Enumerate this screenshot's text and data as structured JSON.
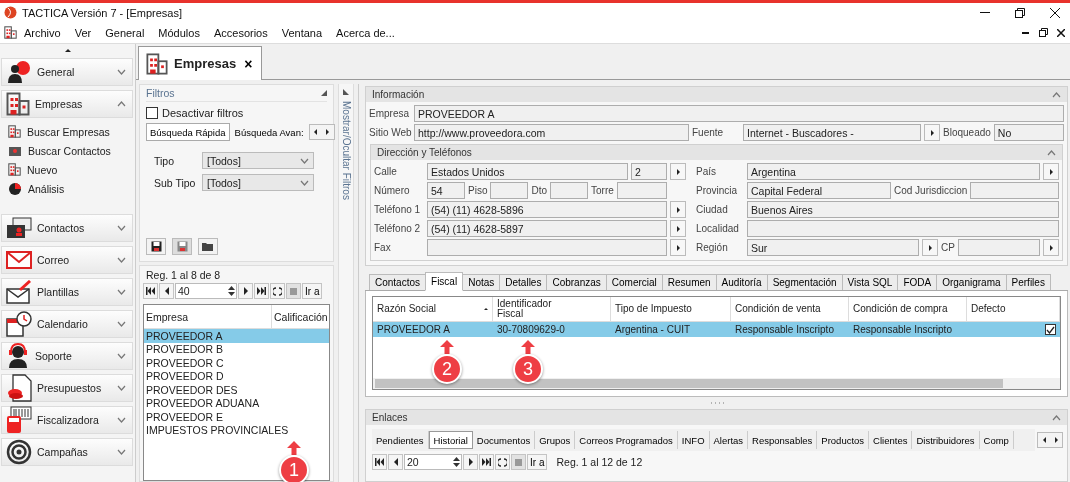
{
  "window": {
    "title": "TACTICA Versión 7 - [Empresas]"
  },
  "menu": [
    {
      "label": "Archivo"
    },
    {
      "label": "Ver"
    },
    {
      "label": "General"
    },
    {
      "label": "Módulos"
    },
    {
      "label": "Accesorios"
    },
    {
      "label": "Ventana"
    },
    {
      "label": "Acerca de..."
    }
  ],
  "sidebar": {
    "groups": [
      {
        "label": "General",
        "expanded": false
      },
      {
        "label": "Empresas",
        "expanded": true,
        "items": [
          {
            "label": "Buscar Empresas"
          },
          {
            "label": "Buscar Contactos"
          },
          {
            "label": "Nuevo"
          },
          {
            "label": "Análisis"
          }
        ]
      },
      {
        "label": "Contactos",
        "expanded": false
      },
      {
        "label": "Correo",
        "expanded": false
      },
      {
        "label": "Plantillas",
        "expanded": false
      },
      {
        "label": "Calendario",
        "expanded": false
      },
      {
        "label": "Soporte",
        "expanded": false
      },
      {
        "label": "Presupuestos",
        "expanded": false
      },
      {
        "label": "Fiscalizadora",
        "expanded": false
      },
      {
        "label": "Campañas",
        "expanded": false
      }
    ]
  },
  "document_tab": {
    "label": "Empresas",
    "close": "×"
  },
  "filters": {
    "title": "Filtros",
    "disable_filters": {
      "label": "Desactivar filtros",
      "checked": false
    },
    "tabs": [
      {
        "label": "Búsqueda Rápida",
        "selected": true
      },
      {
        "label": "Búsqueda Avan:",
        "selected": false
      }
    ],
    "fields": [
      {
        "label": "Tipo",
        "value": "[Todos]"
      },
      {
        "label": "Sub Tipo",
        "value": "[Todos]"
      }
    ],
    "toggle_label": "Mostrar/Ocultar Filtros"
  },
  "list": {
    "record_info": "Reg. 1 al 8 de 8",
    "page_size": "40",
    "goto": "Ir a",
    "columns": [
      "Empresa",
      "Calificación"
    ],
    "rows": [
      {
        "name": "PROVEEDOR A",
        "selected": true
      },
      {
        "name": "PROVEEDOR B",
        "selected": false
      },
      {
        "name": "PROVEEDOR C",
        "selected": false
      },
      {
        "name": "PROVEEDOR D",
        "selected": false
      },
      {
        "name": "PROVEEDOR DES",
        "selected": false
      },
      {
        "name": "PROVEEDOR ADUANA",
        "selected": false
      },
      {
        "name": "PROVEEDOR E",
        "selected": false
      },
      {
        "name": "IMPUESTOS PROVINCIALES",
        "selected": false
      }
    ]
  },
  "info": {
    "title": "Información",
    "empresa": {
      "label": "Empresa",
      "value": "PROVEEDOR A"
    },
    "web": {
      "label": "Sitio Web",
      "value": "http://www.proveedora.com"
    },
    "source": {
      "label": "Fuente",
      "value": "Internet - Buscadores -"
    },
    "blocked": {
      "label": "Bloqueado",
      "value": "No"
    }
  },
  "address": {
    "title": "Dirección y Teléfonos",
    "street": {
      "label": "Calle",
      "value": "Estados Unidos",
      "number": "2"
    },
    "number": {
      "label": "Número",
      "value": "54"
    },
    "floor": {
      "label": "Piso"
    },
    "apartment": {
      "label": "Dto"
    },
    "tower": {
      "label": "Torre"
    },
    "phone1": {
      "label": "Teléfono 1",
      "value": "(54) (11) 4628-5896"
    },
    "phone2": {
      "label": "Teléfono 2",
      "value": "(54) (11) 4628-5897"
    },
    "fax": {
      "label": "Fax"
    },
    "country": {
      "label": "País",
      "value": "Argentina"
    },
    "province": {
      "label": "Provincia",
      "value": "Capital Federal"
    },
    "jurisdiction": {
      "label": "Cod Jurisdiccion"
    },
    "city": {
      "label": "Ciudad",
      "value": "Buenos Aires"
    },
    "locality": {
      "label": "Localidad"
    },
    "region": {
      "label": "Región",
      "value": "Sur"
    },
    "zip": {
      "label": "CP"
    }
  },
  "detail_tabs": [
    {
      "label": "Contactos",
      "selected": false
    },
    {
      "label": "Fiscal",
      "selected": true
    },
    {
      "label": "Notas",
      "selected": false
    },
    {
      "label": "Detalles",
      "selected": false
    },
    {
      "label": "Cobranzas",
      "selected": false
    },
    {
      "label": "Comercial",
      "selected": false
    },
    {
      "label": "Resumen",
      "selected": false
    },
    {
      "label": "Auditoría",
      "selected": false
    },
    {
      "label": "Segmentación",
      "selected": false
    },
    {
      "label": "Vista SQL",
      "selected": false
    },
    {
      "label": "FODA",
      "selected": false
    },
    {
      "label": "Organigrama",
      "selected": false
    },
    {
      "label": "Perfiles",
      "selected": false
    }
  ],
  "fiscal_grid": {
    "columns": [
      "Razón Social",
      "Identificador Fiscal",
      "Tipo de Impuesto",
      "Condición de venta",
      "Condición de compra",
      "Defecto"
    ],
    "rows": [
      {
        "cells": [
          "PROVEEDOR A",
          "30-70809629-0",
          "Argentina - CUIT",
          "Responsable Inscripto",
          "Responsable Inscripto"
        ],
        "default": true,
        "selected": true
      }
    ]
  },
  "links": {
    "title": "Enlaces",
    "tabs": [
      {
        "label": "Pendientes",
        "selected": false
      },
      {
        "label": "Historial",
        "selected": true
      },
      {
        "label": "Documentos",
        "selected": false
      },
      {
        "label": "Grupos",
        "selected": false
      },
      {
        "label": "Correos Programados",
        "selected": false
      },
      {
        "label": "INFO",
        "selected": false
      },
      {
        "label": "Alertas",
        "selected": false
      },
      {
        "label": "Responsables",
        "selected": false
      },
      {
        "label": "Productos",
        "selected": false
      },
      {
        "label": "Clientes",
        "selected": false
      },
      {
        "label": "Distribuidores",
        "selected": false
      },
      {
        "label": "Comp",
        "selected": false
      }
    ],
    "page_size": "20",
    "goto": "Ir a",
    "record_info": "Reg. 1 al 12 de 12"
  },
  "annotations": [
    {
      "label": "1"
    },
    {
      "label": "2"
    },
    {
      "label": "3"
    }
  ]
}
